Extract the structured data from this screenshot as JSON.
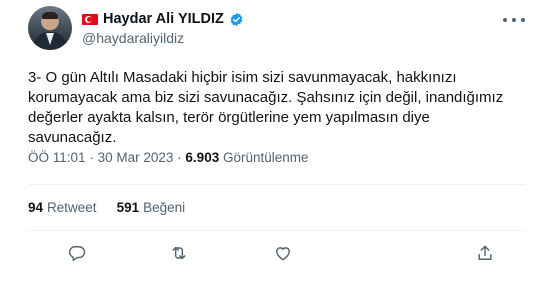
{
  "author": {
    "display_name": "Haydar Ali YILDIZ",
    "handle": "@haydaraliyildiz",
    "flag_icon": "turkey-flag-icon",
    "verified_icon": "verified-badge-icon",
    "verified_color": "#1d9bf0"
  },
  "tweet": {
    "text": "3- O gün Altılı Masadaki hiçbir isim sizi savunmayacak, hakkınızı\nkorumayacak ama biz sizi savunacağız. Şahsınız için değil, inandığımız\ndeğerler ayakta kalsın, terör örgütlerine yem yapılmasın diye\nsavunacağız."
  },
  "meta": {
    "time": "ÖÖ 11:01",
    "separator": "·",
    "date": "30 Mar 2023",
    "views_count": "6.903",
    "views_label": "Görüntülenme"
  },
  "stats": {
    "retweets_count": "94",
    "retweets_label": "Retweet",
    "likes_count": "591",
    "likes_label": "Beğeni"
  },
  "actions": [
    "reply-icon",
    "retweet-icon",
    "like-icon",
    "share-icon"
  ],
  "colors": {
    "text": "#0f1419",
    "secondary": "#536471",
    "divider": "#eff3f4"
  }
}
